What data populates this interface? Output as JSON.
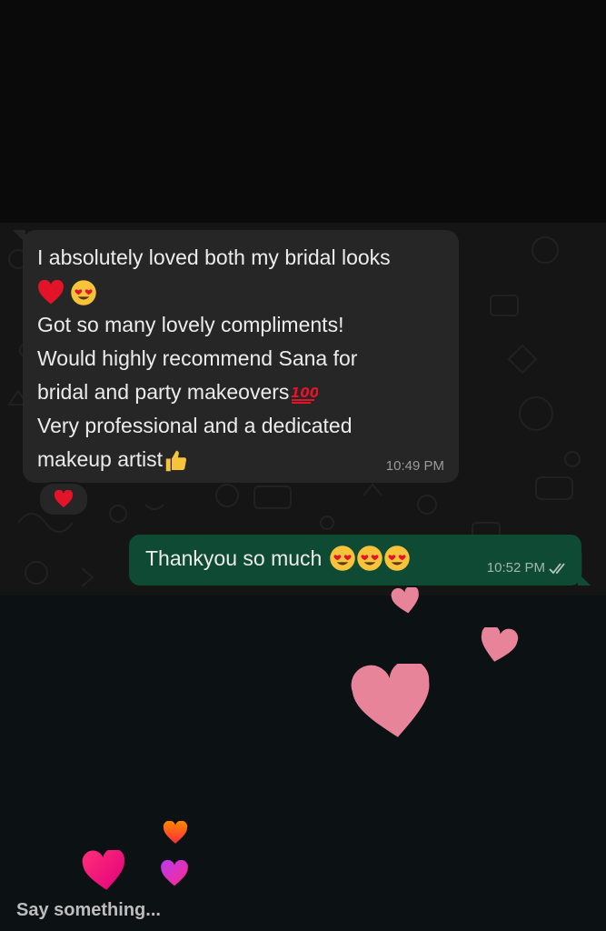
{
  "incoming_message": {
    "lines": [
      "I absolutely loved both my bridal looks",
      "",
      "Got so many lovely compliments!",
      "Would highly recommend Sana for",
      "bridal and party makeovers",
      "Very professional and a dedicated",
      "makeup artist"
    ],
    "time": "10:49 PM",
    "reaction": "heart"
  },
  "outgoing_message": {
    "text": "Thankyou so much",
    "time": "10:52 PM",
    "status": "read"
  },
  "story_reply": {
    "placeholder": "Say something..."
  },
  "colors": {
    "incoming_bubble": "#262626",
    "outgoing_bubble": "#0f4a34",
    "floating_heart": "#e8849a"
  }
}
